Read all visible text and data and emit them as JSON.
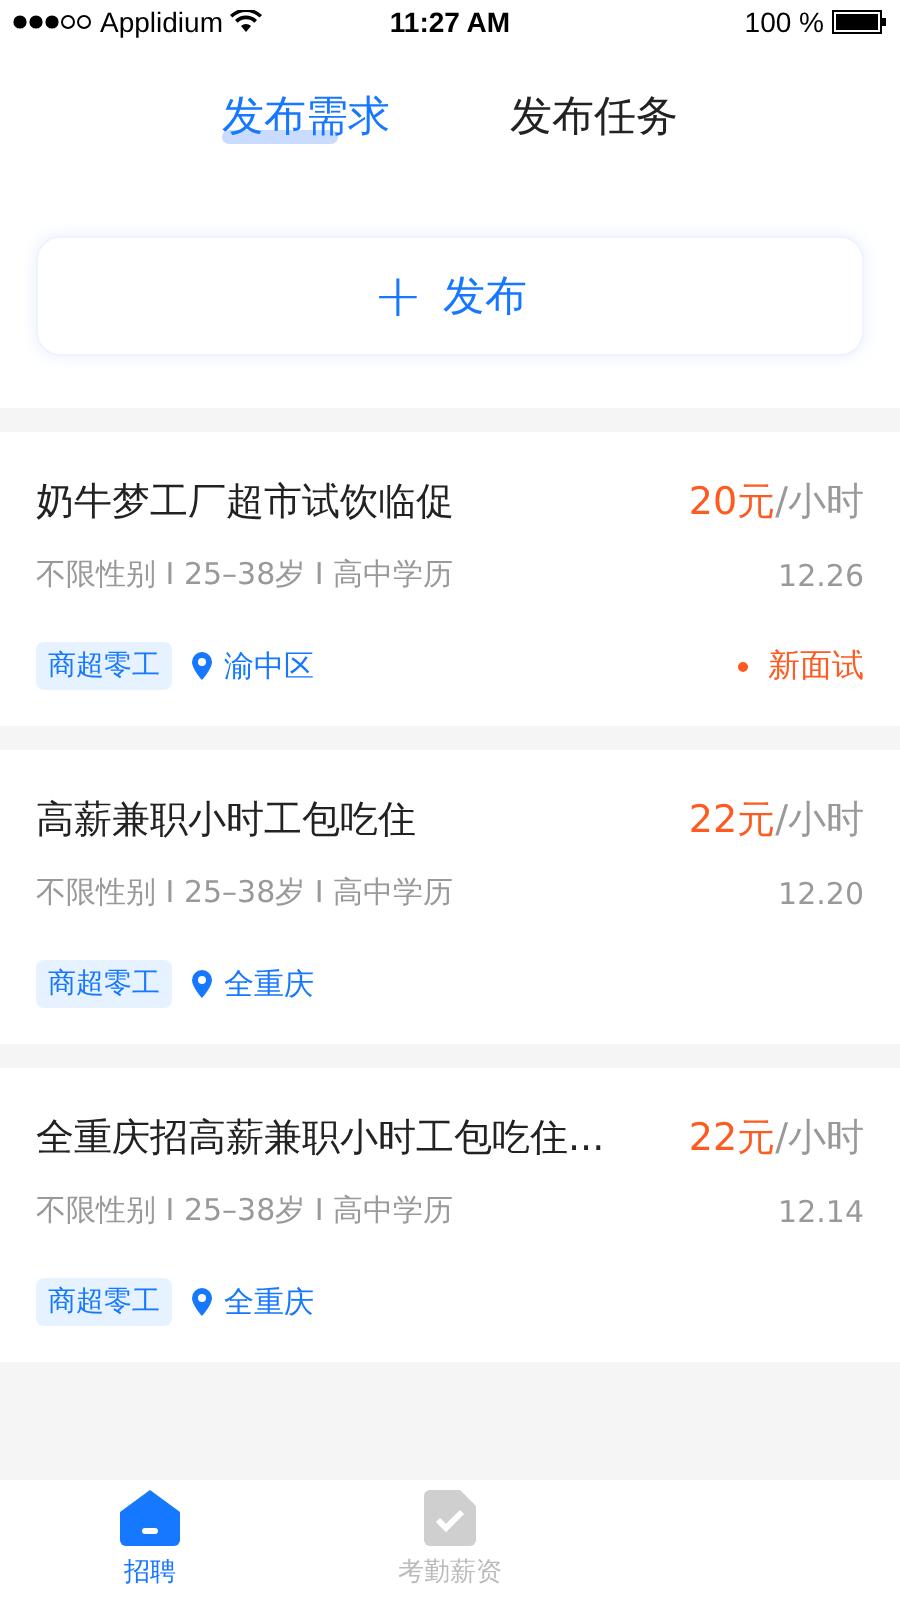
{
  "status_bar": {
    "carrier": "Applidium",
    "time": "11:27 AM",
    "battery": "100 %"
  },
  "tabs": [
    {
      "label": "发布需求",
      "selected": true
    },
    {
      "label": "发布任务",
      "selected": false
    }
  ],
  "publish_button": {
    "icon": "+",
    "label": "发布"
  },
  "jobs": [
    {
      "title": "奶牛梦工厂超市试饮临促",
      "price": "20元",
      "unit": "/小时",
      "requirements": "不限性别 I 25–38岁 I 高中学历",
      "date": "12.26",
      "tag": "商超零工",
      "location": "渝中区",
      "status": "新面试"
    },
    {
      "title": "高薪兼职小时工包吃住",
      "price": "22元",
      "unit": "/小时",
      "requirements": "不限性别 I 25–38岁 I 高中学历",
      "date": "12.20",
      "tag": "商超零工",
      "location": "全重庆"
    },
    {
      "title": "全重庆招高薪兼职小时工包吃住...",
      "price": "22元",
      "unit": "/小时",
      "requirements": "不限性别 I 25–38岁 I 高中学历",
      "date": "12.14",
      "tag": "商超零工",
      "location": "全重庆"
    }
  ],
  "bottom_tabs": [
    {
      "label": "招聘",
      "kind": "home",
      "selected": true
    },
    {
      "label": "考勤薪资",
      "kind": "check",
      "selected": false
    }
  ]
}
